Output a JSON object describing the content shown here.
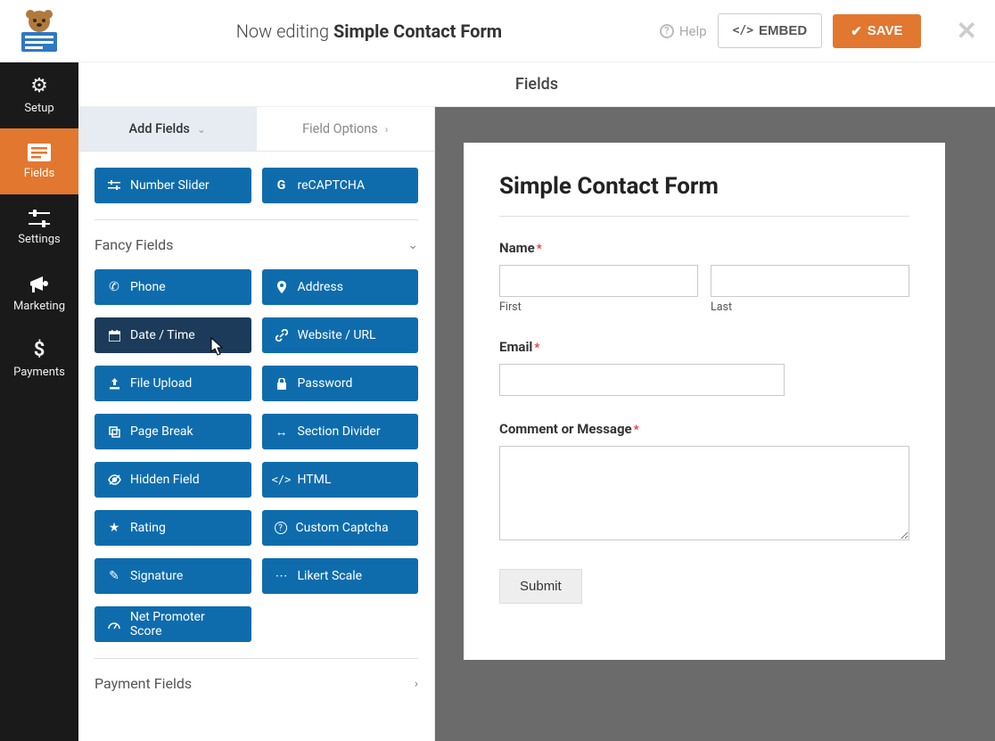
{
  "header": {
    "editing_prefix": "Now editing ",
    "form_name": "Simple Contact Form",
    "help": "Help",
    "embed": "EMBED",
    "save": "SAVE"
  },
  "nav": {
    "setup": "Setup",
    "fields": "Fields",
    "settings": "Settings",
    "marketing": "Marketing",
    "payments": "Payments"
  },
  "section_heading": "Fields",
  "tabs": {
    "add": "Add Fields",
    "options": "Field Options"
  },
  "groups": {
    "fancy": "Fancy Fields",
    "payment": "Payment Fields"
  },
  "buttons": {
    "number_slider": "Number Slider",
    "recaptcha": "reCAPTCHA",
    "phone": "Phone",
    "address": "Address",
    "date_time": "Date / Time",
    "website": "Website / URL",
    "file_upload": "File Upload",
    "password": "Password",
    "page_break": "Page Break",
    "section_divider": "Section Divider",
    "hidden_field": "Hidden Field",
    "html": "HTML",
    "rating": "Rating",
    "custom_captcha": "Custom Captcha",
    "signature": "Signature",
    "likert": "Likert Scale",
    "nps": "Net Promoter Score"
  },
  "form": {
    "title": "Simple Contact Form",
    "name_label": "Name",
    "first": "First",
    "last": "Last",
    "email_label": "Email",
    "comment_label": "Comment or Message",
    "submit": "Submit",
    "asterisk": "*"
  },
  "colors": {
    "accent": "#e27730",
    "primary_btn": "#0e6cad",
    "hover_btn": "#1c3b5a"
  }
}
